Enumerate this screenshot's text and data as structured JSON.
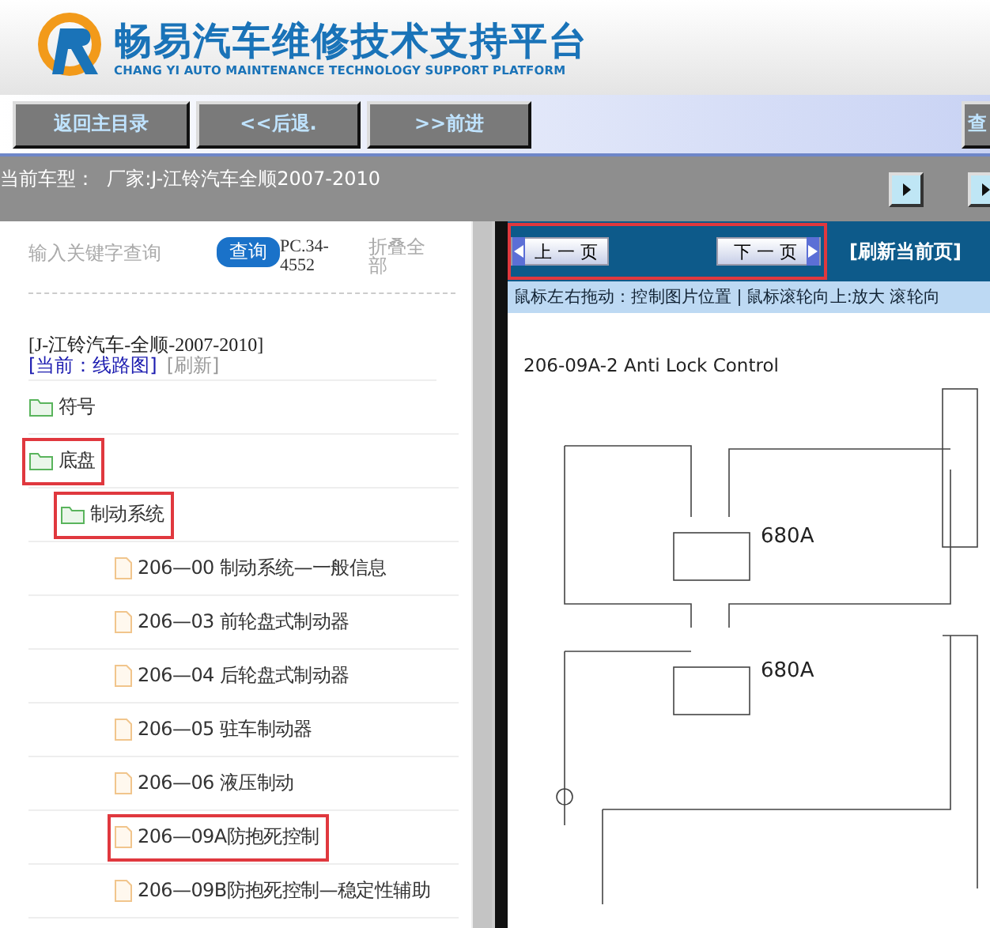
{
  "header": {
    "title": "畅易汽车维修技术支持平台",
    "subtitle": "CHANG YI AUTO MAINTENANCE TECHNOLOGY SUPPORT PLATFORM"
  },
  "toolbar": {
    "buttons": [
      "返回主目录",
      "<<后退.",
      ">>前进"
    ],
    "cut_button": "查"
  },
  "vehicle_bar": {
    "text": "当前车型：  厂家:J-江铃汽车全顺2007-2010"
  },
  "sidebar": {
    "search": {
      "placeholder": "输入关键字查询"
    },
    "search_button": "查询",
    "code": "PC.34-4552",
    "collapse_all": "折叠全部",
    "vehicle": "[J-江铃汽车-全顺-2007-2010]",
    "current": "[当前：线路图]",
    "refresh": "[刷新]",
    "tree": [
      {
        "kind": "folder",
        "label": "符号",
        "highlighted": false
      },
      {
        "kind": "folder",
        "label": "底盘",
        "highlighted": true,
        "children": [
          {
            "kind": "folder",
            "label": "制动系统",
            "highlighted": true,
            "children": [
              {
                "kind": "file",
                "label": "206—00 制动系统—一般信息",
                "highlighted": false
              },
              {
                "kind": "file",
                "label": "206—03 前轮盘式制动器",
                "highlighted": false
              },
              {
                "kind": "file",
                "label": "206—04 后轮盘式制动器",
                "highlighted": false
              },
              {
                "kind": "file",
                "label": "206—05 驻车制动器",
                "highlighted": false
              },
              {
                "kind": "file",
                "label": "206—06 液压制动",
                "highlighted": false
              },
              {
                "kind": "file",
                "label": "206—09A防抱死控制",
                "highlighted": true
              },
              {
                "kind": "file",
                "label": "206—09B防抱死控制—稳定性辅助",
                "highlighted": false
              }
            ]
          }
        ]
      }
    ]
  },
  "viewer": {
    "pager_highlighted": true,
    "prev": "上 一 页",
    "next": "下 一 页",
    "refresh": "[刷新当前页]",
    "hint": "鼠标左右拖动：控制图片位置 | 鼠标滚轮向上:放大  滚轮向",
    "document": {
      "title": "206-09A-2 Anti Lock Control",
      "labels": [
        "680A",
        "680A"
      ]
    }
  }
}
